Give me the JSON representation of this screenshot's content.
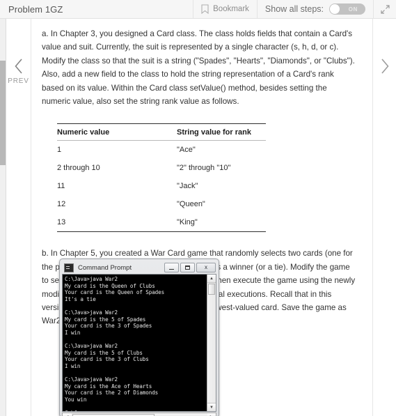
{
  "header": {
    "title": "Problem 1GZ",
    "bookmark_label": "Bookmark",
    "bookmark_icon": "bookmark-ribbon-icon",
    "show_all_steps_label": "Show all steps:",
    "toggle_state_label": "ON",
    "expand_icon": "expand-diagonal-icon"
  },
  "nav": {
    "prev_label": "PREV",
    "prev_icon": "chevron-left-icon",
    "next_icon": "chevron-right-icon"
  },
  "content": {
    "paragraph_a": "a. In Chapter 3, you designed a Card class. The class holds fields that contain a Card's value and suit. Currently, the suit is represented by a single character (s, h, d, or c). Modify the class so that the suit is a string (\"Spades\", \"Hearts\", \"Diamonds\", or \"Clubs\"). Also, add a new field to the class to hold the string representation of a Card's rank based on its value. Within the Card class setValue() method, besides setting the numeric value, also set the string rank value as follows.",
    "paragraph_b": "b. In Chapter 5, you created a War Card game that randomly selects two cards (one for the player and one for the computer) and declares a winner (or a tie). Modify the game to set each Card's suit as the appropriate string, then execute the game using the newly modified Card class. Figure 7-23 shows four typical executions. Recall that in this version of War, you assume that the Ace is the lowest-valued card. Save the game as War2.java."
  },
  "rank_table": {
    "headers": [
      "Numeric value",
      "String value for rank"
    ],
    "rows": [
      [
        "1",
        "\"Ace\""
      ],
      [
        "2 through 10",
        "\"2\" through \"10\""
      ],
      [
        "11",
        "\"Jack\""
      ],
      [
        "12",
        "\"Queen\""
      ],
      [
        "13",
        "\"King\""
      ]
    ]
  },
  "command_prompt": {
    "title": "Command Prompt",
    "icon": "console-window-icon",
    "minimize_label": "minimize",
    "maximize_label": "maximize",
    "close_label": "x",
    "console_text": "C:\\Java>java War2\nMy card is the Queen of Clubs\nYour card is the Queen of Spades\nIt's a tie\n\nC:\\Java>java War2\nMy card is the 5 of Spades\nYour card is the 3 of Spades\nI win\n\nC:\\Java>java War2\nMy card is the 5 of Clubs\nYour card is the 3 of Clubs\nI win\n\nC:\\Java>java War2\nMy card is the Ace of Hearts\nYour card is the 2 of Diamonds\nYou win\n\nC:\\Java>",
    "scroll_up_glyph": "▲",
    "scroll_down_glyph": "▼",
    "scroll_left_glyph": "◀",
    "scroll_right_glyph": "▶"
  }
}
